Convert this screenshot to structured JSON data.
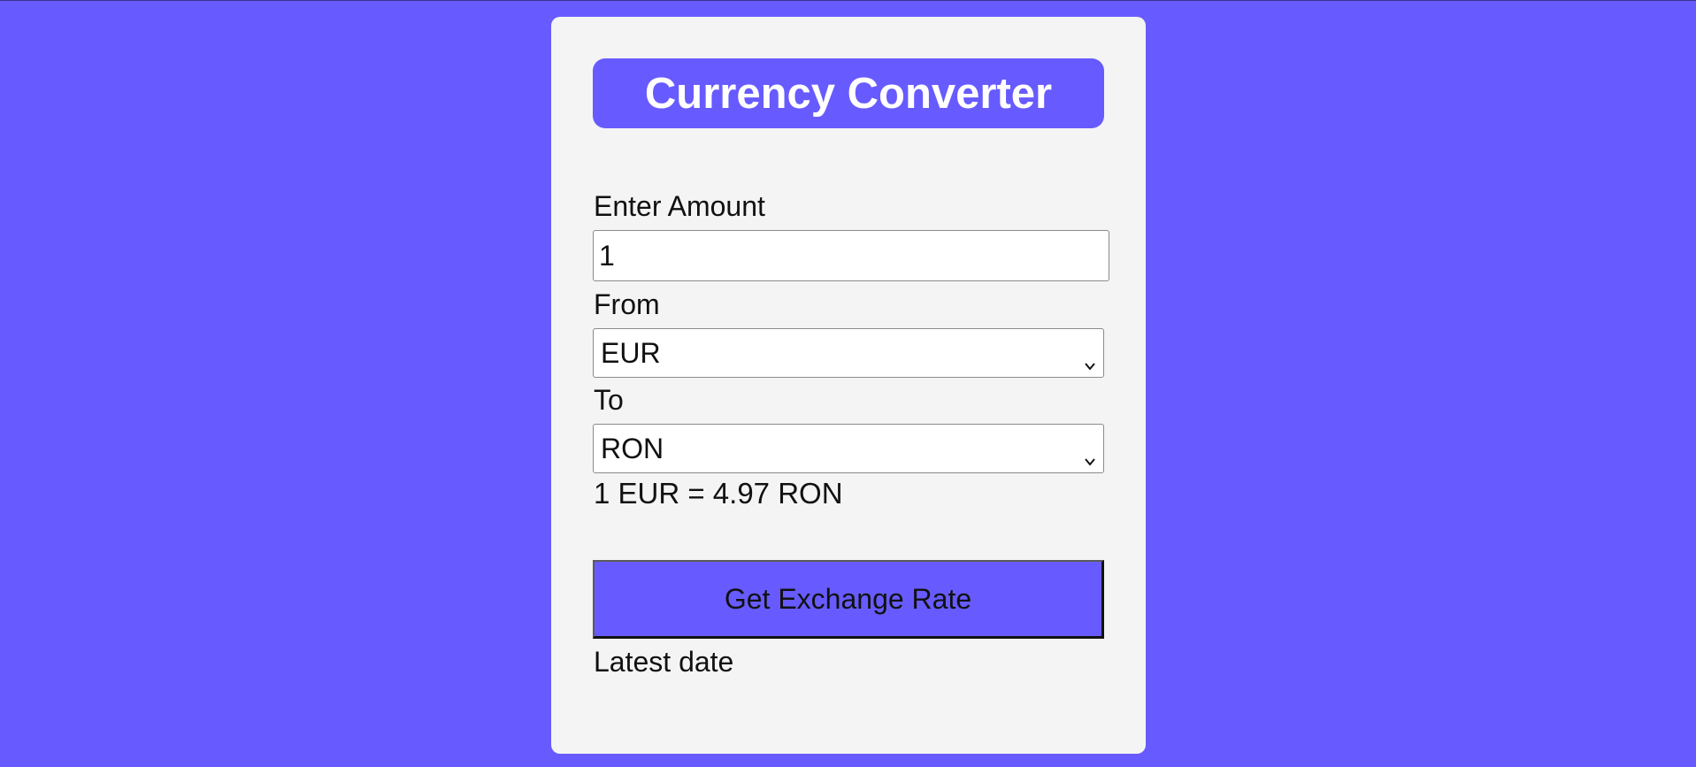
{
  "app": {
    "title": "Currency Converter"
  },
  "form": {
    "amount_label": "Enter Amount",
    "amount_value": "1",
    "from_label": "From",
    "from_value": "EUR",
    "to_label": "To",
    "to_value": "RON",
    "rate_text": "1 EUR = 4.97 RON",
    "button_label": "Get Exchange Rate",
    "latest_date_label": "Latest date"
  },
  "icons": {
    "select_arrow": "chevron-down-icon"
  },
  "colors": {
    "background": "#675bff",
    "card": "#f4f4f4",
    "accent": "#675bff",
    "title_text": "#ffffff"
  }
}
